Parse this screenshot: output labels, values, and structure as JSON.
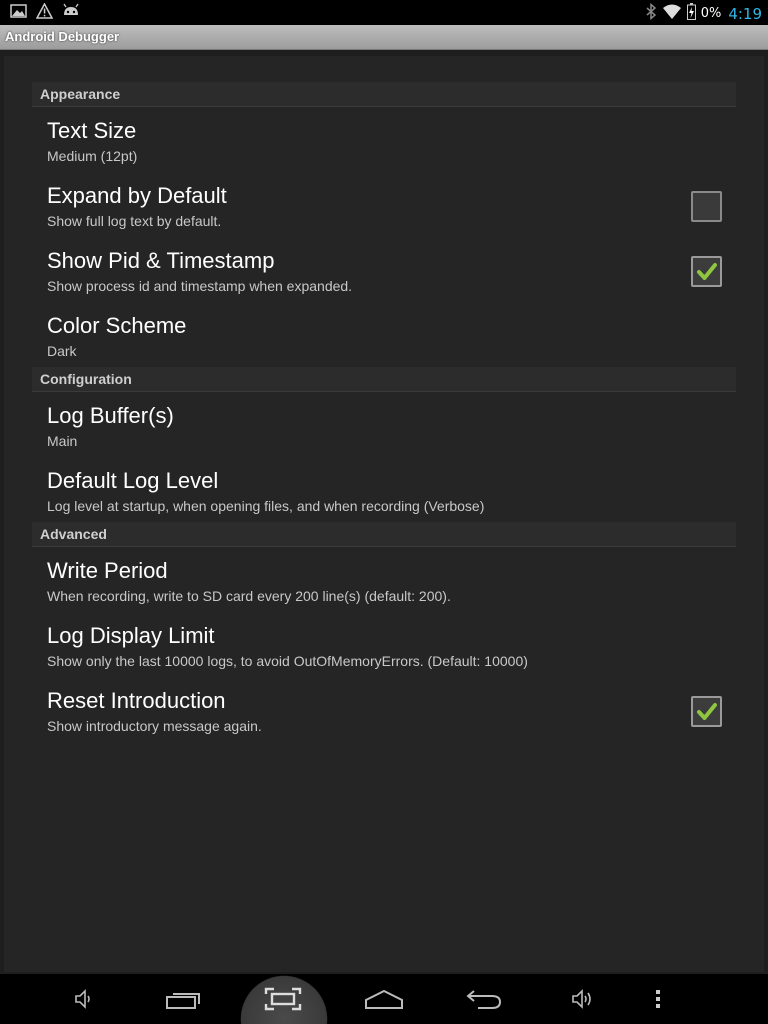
{
  "status_bar": {
    "battery_percent": "0%",
    "time": "4:19",
    "left_icons": [
      "picture-icon",
      "warning-icon",
      "android-icon"
    ],
    "right_icons": [
      "bluetooth-icon",
      "wifi-icon",
      "battery-icon"
    ]
  },
  "app": {
    "title": "Android Debugger"
  },
  "sections": [
    {
      "category": "Appearance",
      "items": [
        {
          "title": "Text Size",
          "summary": "Medium (12pt)",
          "checkbox": null
        },
        {
          "title": "Expand by Default",
          "summary": "Show full log text by default.",
          "checkbox": false
        },
        {
          "title": "Show Pid & Timestamp",
          "summary": "Show process id and timestamp when expanded.",
          "checkbox": true
        },
        {
          "title": "Color Scheme",
          "summary": "Dark",
          "checkbox": null
        }
      ]
    },
    {
      "category": "Configuration",
      "items": [
        {
          "title": "Log Buffer(s)",
          "summary": "Main",
          "checkbox": null
        },
        {
          "title": "Default Log Level",
          "summary": "Log level at startup, when opening files, and when recording (Verbose)",
          "checkbox": null
        }
      ]
    },
    {
      "category": "Advanced",
      "items": [
        {
          "title": "Write Period",
          "summary": "When recording, write to SD card every 200 line(s) (default: 200).",
          "checkbox": null
        },
        {
          "title": "Log Display Limit",
          "summary": "Show only the last 10000 logs, to avoid OutOfMemoryErrors. (Default: 10000)",
          "checkbox": null
        },
        {
          "title": "Reset Introduction",
          "summary": "Show introductory message again.",
          "checkbox": true
        }
      ]
    }
  ],
  "nav_bar": {
    "buttons": [
      "volume-down-icon",
      "recent-apps-icon",
      "screenshot-icon",
      "home-icon",
      "back-icon",
      "volume-up-icon",
      "menu-icon"
    ],
    "active": "screenshot-icon"
  },
  "colors": {
    "accent_time": "#33b5e5",
    "check_green": "#8ec63f",
    "background": "#252526",
    "category_background": "#2c2c2c"
  }
}
